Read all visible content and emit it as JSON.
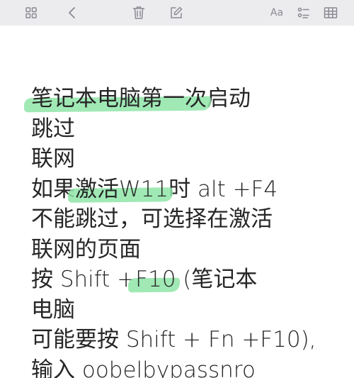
{
  "toolbar": {
    "icons": [
      "grid-icon",
      "back-chevron-icon",
      "trash-icon",
      "edit-icon",
      "text-format-icon",
      "checklist-icon",
      "table-icon"
    ],
    "font_label": "Aa"
  },
  "note": {
    "lines": [
      {
        "hl": "笔记本电脑第一次",
        "rest": "启动"
      },
      {
        "text": "跳过"
      },
      {
        "text": "联网"
      },
      {
        "pre": "如果",
        "hl": "激活W11",
        "rest": "时 alt +F4"
      },
      {
        "text": "不能跳过，可选择在激活"
      },
      {
        "text": "联网的页面"
      },
      {
        "pre": "按 Shift +",
        "hl": "F10",
        "rest": " (笔记本"
      },
      {
        "text": "电脑"
      },
      {
        "text": "可能要按 Shift + Fn +F10),"
      },
      {
        "text": "输入 oobelbypassnro"
      }
    ]
  },
  "colors": {
    "toolbar_bg": "#ececef",
    "icon": "#8a8a92",
    "text": "#262626",
    "highlight": "#8fe5a8"
  }
}
